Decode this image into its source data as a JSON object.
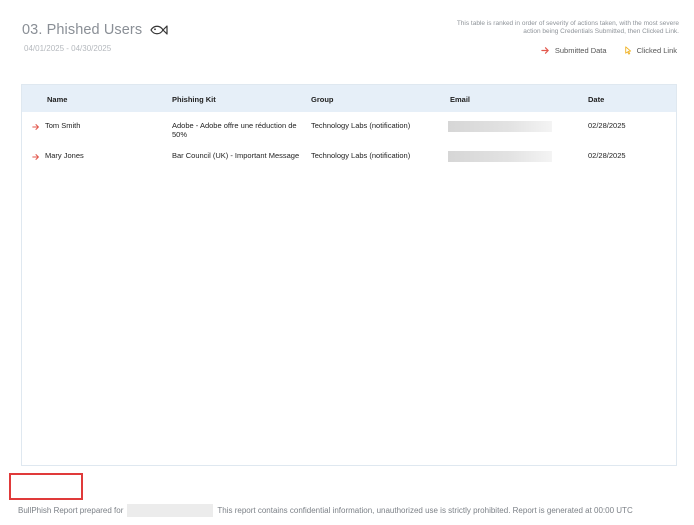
{
  "header": {
    "title": "03. Phished Users",
    "date_range": "04/01/2025 - 04/30/2025",
    "note": "This table is ranked in order of severity of actions taken, with the most severe action being Credentials Submitted, then Clicked Link.",
    "legend": [
      {
        "label": "Submitted Data",
        "icon": "arrow-right-icon",
        "color": "#e2574c"
      },
      {
        "label": "Clicked Link",
        "icon": "pointer-icon",
        "color": "#f0b429"
      }
    ]
  },
  "table": {
    "columns": [
      "Name",
      "Phishing Kit",
      "Group",
      "Email",
      "Date"
    ],
    "rows": [
      {
        "name": "Tom Smith",
        "action_icon": "arrow-right-icon",
        "kit": "Adobe - Adobe offre une réduction de 50%",
        "group": "Technology Labs (notification)",
        "email": "",
        "date": "02/28/2025"
      },
      {
        "name": "Mary Jones",
        "action_icon": "arrow-right-icon",
        "kit": "Bar Council (UK) - Important Message",
        "group": "Technology Labs (notification)",
        "email": "",
        "date": "02/28/2025"
      }
    ]
  },
  "footer": {
    "prefix": "BullPhish Report prepared for",
    "text": "This report contains confidential information, unauthorized use is strictly prohibited. Report is generated at 00:00 UTC"
  },
  "colors": {
    "accent_red": "#e2574c",
    "accent_yellow": "#f0b429",
    "header_bg": "#e6eff8"
  }
}
